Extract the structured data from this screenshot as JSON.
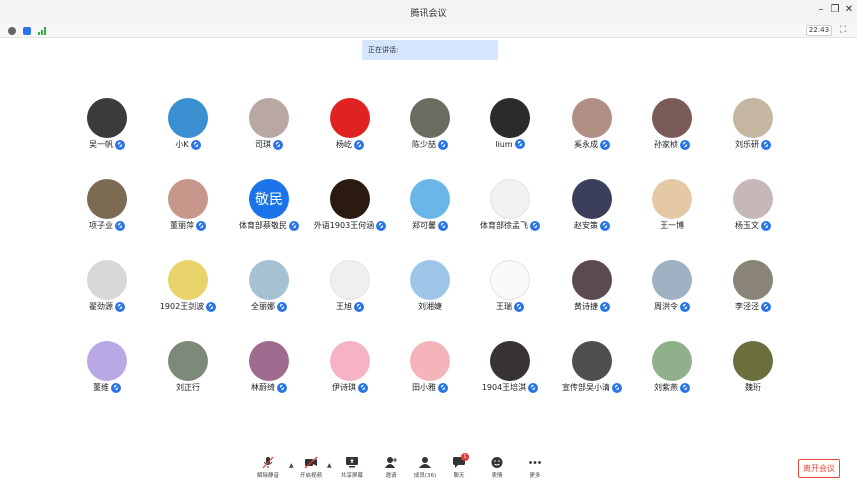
{
  "window": {
    "title": "腾讯会议"
  },
  "status": {
    "time": "22:43",
    "speaking_label": "正在讲话:"
  },
  "participants": [
    {
      "name": "吴一帆",
      "mic": "on",
      "color": "#3b3b3b"
    },
    {
      "name": "小K",
      "mic": "on",
      "color": "#3a8fd0"
    },
    {
      "name": "司琪",
      "mic": "on",
      "color": "#b9a7a3"
    },
    {
      "name": "杨屹",
      "mic": "speaking",
      "color": "#e02222"
    },
    {
      "name": "陈少喆",
      "mic": "on",
      "color": "#6b6b60"
    },
    {
      "name": "lium",
      "mic": "on",
      "color": "#2b2b2b"
    },
    {
      "name": "奚永成",
      "mic": "on",
      "color": "#b08f84"
    },
    {
      "name": "孙家桢",
      "mic": "on",
      "color": "#7a5a56"
    },
    {
      "name": "刘乐研",
      "mic": "on",
      "color": "#c4b6a0"
    },
    {
      "name": "项子业",
      "mic": "on",
      "color": "#7d6a52"
    },
    {
      "name": "董丽萍",
      "mic": "on",
      "color": "#c6978a"
    },
    {
      "name": "体育部蔡敬民",
      "mic": "on",
      "color": "#1a73e8",
      "text": "敬民"
    },
    {
      "name": "外语1903王何涵",
      "mic": "on",
      "color": "#2a1a10"
    },
    {
      "name": "郑可馨",
      "mic": "on",
      "color": "#6ab6e8"
    },
    {
      "name": "体育部徐孟飞",
      "mic": "on",
      "color": "#f2f2f2"
    },
    {
      "name": "赵安策",
      "mic": "on",
      "color": "#3b3f5b"
    },
    {
      "name": "王一博",
      "mic": "off",
      "color": "#e4c9a4"
    },
    {
      "name": "杨玉文",
      "mic": "on",
      "color": "#c7b8b8"
    },
    {
      "name": "翟劲源",
      "mic": "on",
      "color": "#d8d8d8"
    },
    {
      "name": "1902王剑波",
      "mic": "on",
      "color": "#e8d46a"
    },
    {
      "name": "全丽娜",
      "mic": "on",
      "color": "#a5c2d2"
    },
    {
      "name": "王旭",
      "mic": "on",
      "color": "#efefef"
    },
    {
      "name": "刘湘婕",
      "mic": "off",
      "color": "#9ec5e8"
    },
    {
      "name": "王瑞",
      "mic": "on",
      "color": "#fafafa"
    },
    {
      "name": "黄诗捷",
      "mic": "on",
      "color": "#5a4b52"
    },
    {
      "name": "周洪令",
      "mic": "on",
      "color": "#9fb1c2"
    },
    {
      "name": "李泾泾",
      "mic": "on",
      "color": "#8a8478"
    },
    {
      "name": "董维",
      "mic": "on",
      "color": "#b8a9e6"
    },
    {
      "name": "刘正行",
      "mic": "off",
      "color": "#7d8a7a"
    },
    {
      "name": "林蔚绮",
      "mic": "on",
      "color": "#9c6b8e"
    },
    {
      "name": "伊诗琪",
      "mic": "on",
      "color": "#f5b3c5"
    },
    {
      "name": "田小雅",
      "mic": "on",
      "color": "#f4b4b9"
    },
    {
      "name": "1904王培淇",
      "mic": "on",
      "color": "#3a3333"
    },
    {
      "name": "宣传部吴小清",
      "mic": "on",
      "color": "#4f4f4f"
    },
    {
      "name": "刘紫燕",
      "mic": "on",
      "color": "#8fb08a"
    },
    {
      "name": "魏珩",
      "mic": "off",
      "color": "#6b6f3e"
    }
  ],
  "toolbar": {
    "mute_label": "解除静音",
    "video_label": "开启视频",
    "share_label": "共享屏幕",
    "invite_label": "邀请",
    "members_label": "成员(36)",
    "chat_label": "聊天",
    "chat_badge": "1",
    "emoji_label": "表情",
    "more_label": "更多",
    "leave_label": "离开会议"
  },
  "colors": {
    "accent": "#2a76e8",
    "danger": "#e64a3a",
    "speaking_bg": "#d5e5fb"
  }
}
